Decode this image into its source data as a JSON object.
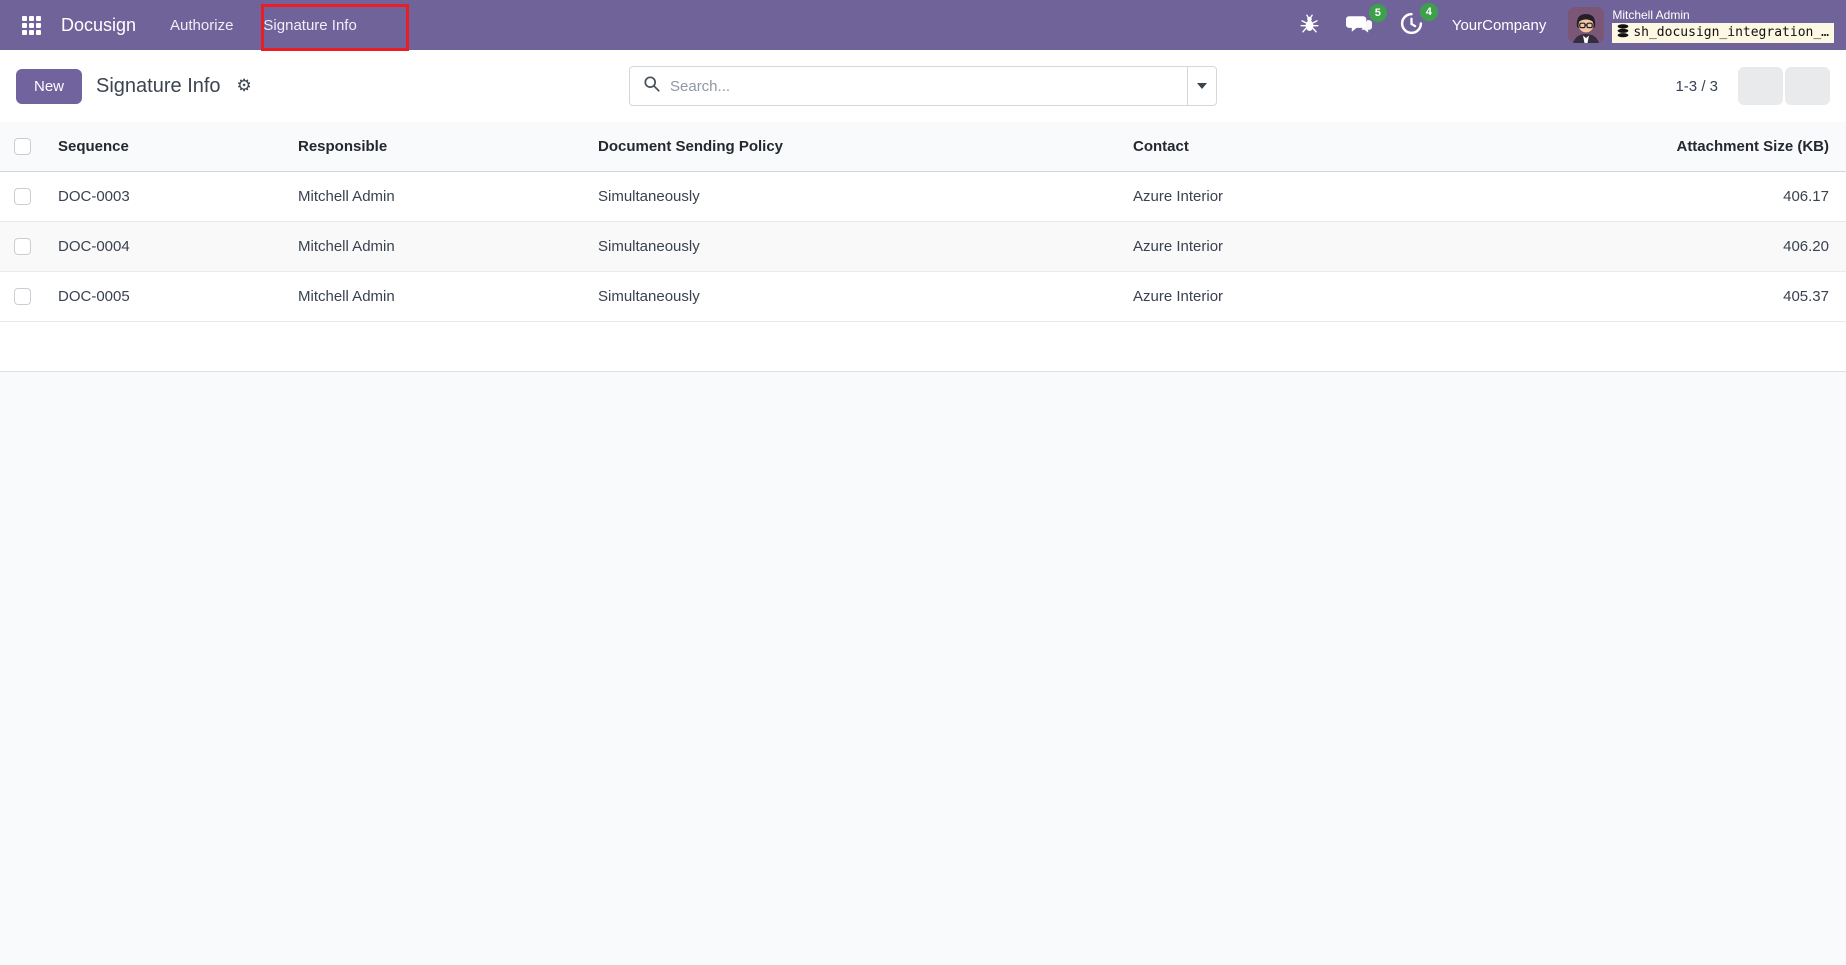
{
  "navbar": {
    "app_name": "Docusign",
    "menu_items": [
      {
        "label": "Authorize"
      },
      {
        "label": "Signature Info",
        "highlighted": true
      }
    ],
    "badges": {
      "messages": "5",
      "activities": "4"
    },
    "company": "YourCompany",
    "user_name": "Mitchell Admin",
    "database": "sh_docusign_integration_…"
  },
  "control_panel": {
    "new_button": "New",
    "title": "Signature Info",
    "gear_icon": "⚙",
    "search_placeholder": "Search...",
    "pager": "1-3 / 3"
  },
  "table": {
    "columns": [
      "Sequence",
      "Responsible",
      "Document Sending Policy",
      "Contact",
      "Attachment Size (KB)"
    ],
    "rows": [
      {
        "sequence": "DOC-0003",
        "responsible": "Mitchell Admin",
        "policy": "Simultaneously",
        "contact": "Azure Interior",
        "size": "406.17"
      },
      {
        "sequence": "DOC-0004",
        "responsible": "Mitchell Admin",
        "policy": "Simultaneously",
        "contact": "Azure Interior",
        "size": "406.20"
      },
      {
        "sequence": "DOC-0005",
        "responsible": "Mitchell Admin",
        "policy": "Simultaneously",
        "contact": "Azure Interior",
        "size": "405.37"
      }
    ]
  },
  "colors": {
    "navbar_bg": "#6f6399",
    "primary_button": "#71639e",
    "badge_green": "#3da14b",
    "annotation_red": "#ea1d25",
    "db_box_bg": "#fcf8e3",
    "page_bg": "#f9fafb"
  },
  "icons": {
    "apps": "3x3-grid",
    "debug": "bug",
    "messages": "chat-bubbles",
    "activities": "clock",
    "search": "magnifier",
    "settings": "gear",
    "database": "db-cylinders",
    "expand": "caret-down"
  }
}
